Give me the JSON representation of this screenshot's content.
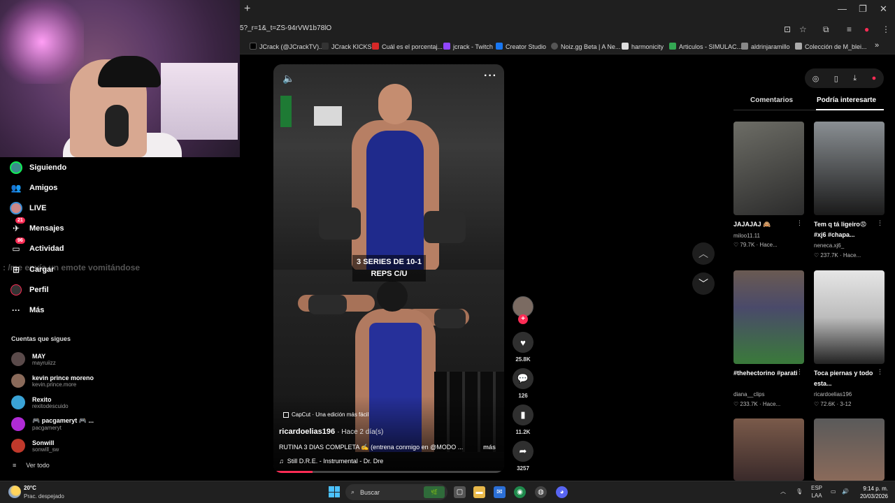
{
  "browser": {
    "url": "5?_r=1&_t=ZS-94rVW1b78lO",
    "bookmarks": [
      {
        "label": "JCrack (@JCrackTV)...",
        "color": "#000000"
      },
      {
        "label": "JCrack KICKS",
        "color": "#333333"
      },
      {
        "label": "Cuál es el porcentaj...",
        "color": "#d62828"
      },
      {
        "label": "jcrack - Twitch",
        "color": "#9146ff"
      },
      {
        "label": "Creator Studio",
        "color": "#1877f2"
      },
      {
        "label": "Noiz.gg Beta | A Ne...",
        "color": "#555555"
      },
      {
        "label": "harmonicity",
        "color": "#dddddd"
      },
      {
        "label": "Articulos - SIMULAC...",
        "color": "#34a853"
      },
      {
        "label": "aldrinjaramillo",
        "color": "#888888"
      },
      {
        "label": "Colección de M_blei...",
        "color": "#aaaaaa"
      }
    ]
  },
  "sidebar": {
    "nav": [
      {
        "label": "Siguiendo",
        "icon": "following-icon"
      },
      {
        "label": "Amigos",
        "icon": "friends-icon"
      },
      {
        "label": "LIVE",
        "icon": "live-icon"
      },
      {
        "label": "Mensajes",
        "icon": "messages-icon",
        "badge": "21"
      },
      {
        "label": "Actividad",
        "icon": "activity-icon",
        "badge": "96"
      },
      {
        "label": "Cargar",
        "icon": "upload-icon"
      },
      {
        "label": "Perfil",
        "icon": "profile-icon"
      },
      {
        "label": "Más",
        "icon": "more-icon"
      }
    ],
    "chat_overlay": ": /me envía un emote vomitándose",
    "following_title": "Cuentas que sigues",
    "following": [
      {
        "name": "MAY",
        "handle": "mayruiizz",
        "color": "#5a4a4a"
      },
      {
        "name": "kevin prince moreno",
        "handle": "kevin.prince.more",
        "color": "#8a6a5a"
      },
      {
        "name": "Rexito",
        "handle": "rexitodescuido",
        "color": "#3aa3d6"
      },
      {
        "name": "🎮 pacgameryt 🎮 ...",
        "handle": "pacgameryt",
        "color": "#b02bd6"
      },
      {
        "name": "Sonwill",
        "handle": "sonwill_sw",
        "color": "#c0392b"
      }
    ],
    "see_all": "Ver todo"
  },
  "video": {
    "caption": "3 SERIES DE 10-1 REPS C/U",
    "capcut": "CapCut · Una edición más fácil",
    "author": "ricardoelias196",
    "time": "· Hace 2 día(s)",
    "description": "RUTINA 3 DIAS COMPLETA ✍️ (entrena conmigo en @MODO ...",
    "more": "más",
    "music": "Still D.R.E. - Instrumental - Dr. Dre",
    "progress": 0.17
  },
  "actions": {
    "likes": "25.8K",
    "comments": "126",
    "saves": "11.2K",
    "shares": "3257"
  },
  "panel": {
    "tabs": [
      "Comentarios",
      "Podría interesarte"
    ],
    "cards": [
      {
        "title": "JAJAJAJ 🙈",
        "user": "miloo11.11",
        "stats": "♡ 79.7K · Hace...",
        "color1": "#6d6d66",
        "color2": "#2b2b2b"
      },
      {
        "title": "Tem q tá ligeiro😡 #xj6 #chapa...",
        "user": "neneca.xj6_",
        "stats": "♡ 237.7K · Hace...",
        "color1": "#8a8f93",
        "color2": "#1a1a1a"
      },
      {
        "title": "#thehectorino #parati",
        "user": "diana__clips",
        "stats": "♡ 233.7K · Hace...",
        "color1": "#6a5a52",
        "color2": "#3a7a3a"
      },
      {
        "title": "Toca piernas y todo esta...",
        "user": "ricardoelias196",
        "stats": "♡ 72.6K · 3-12",
        "color1": "#e6e6e6",
        "color2": "#222222"
      },
      {
        "title": "",
        "user": "",
        "stats": "",
        "color1": "#7a5a4a",
        "color2": "#3a2a2a"
      },
      {
        "title": "",
        "user": "",
        "stats": "",
        "color1": "#5a5a5a",
        "color2": "#8a6a5a"
      }
    ]
  },
  "taskbar": {
    "temp": "20°C",
    "weather": "Prac. despejado",
    "search": "Buscar",
    "lang1": "ESP",
    "lang2": "LAA",
    "time": "9:14 p. m.",
    "date": "20/03/2026"
  }
}
